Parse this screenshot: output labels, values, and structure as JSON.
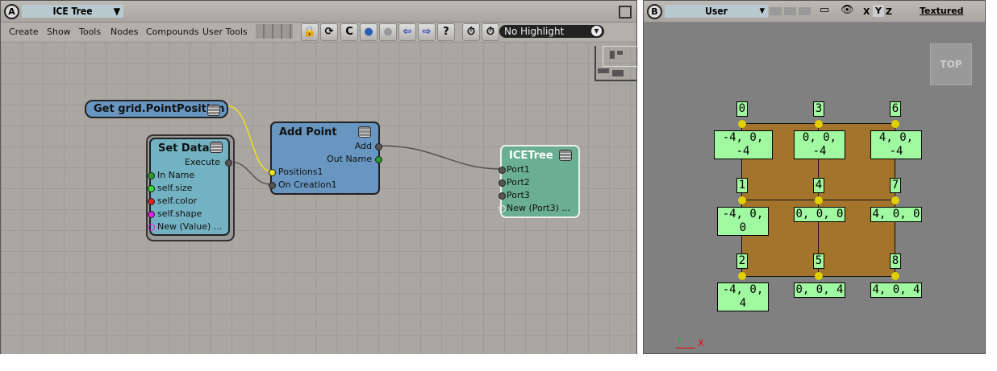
{
  "left_panel": {
    "letter": "A",
    "view_name": "ICE Tree",
    "menu": [
      "Create",
      "Show",
      "Tools",
      "Nodes",
      "Compounds",
      "User Tools"
    ],
    "highlight_select": "No Highlight",
    "icons": [
      "lock-icon",
      "refresh-icon",
      "compound-icon",
      "globe-icon",
      "apple-icon",
      "back-arrow-icon",
      "forward-arrow-icon",
      "help-icon",
      "timer-icon",
      "timer-c-icon"
    ]
  },
  "nodes": {
    "get": {
      "title": "Get grid.PointPosition"
    },
    "set_data": {
      "title": "Set Data",
      "outputs": [
        "Execute"
      ],
      "inputs": [
        "In Name",
        "self.size",
        "self.color",
        "self.shape",
        "New (Value) ..."
      ]
    },
    "add_point": {
      "title": "Add Point",
      "outputs": [
        "Add",
        "Out Name"
      ],
      "inputs": [
        "Positions1",
        "On Creation1"
      ]
    },
    "ice_tree": {
      "title": "ICETree",
      "inputs": [
        "Port1",
        "Port2",
        "Port3",
        "New (Port3) ..."
      ]
    }
  },
  "right_panel": {
    "letter": "B",
    "camera": "User",
    "axes": [
      "X",
      "Y",
      "Z"
    ],
    "display_mode": "Textured",
    "view_cube": "TOP",
    "points": [
      {
        "index": "0",
        "coords": "-4, 0, -4"
      },
      {
        "index": "1",
        "coords": "-4, 0, 0"
      },
      {
        "index": "2",
        "coords": "-4, 0, 4"
      },
      {
        "index": "3",
        "coords": "0, 0, -4"
      },
      {
        "index": "4",
        "coords": "0, 0, 0"
      },
      {
        "index": "5",
        "coords": "0, 0, 4"
      },
      {
        "index": "6",
        "coords": "4, 0, -4"
      },
      {
        "index": "7",
        "coords": "4, 0, 0"
      },
      {
        "index": "8",
        "coords": "4, 0, 4"
      }
    ],
    "axis_label_x": "X",
    "grid_color": "#a3752c",
    "label_color": "#a0f8a0"
  }
}
